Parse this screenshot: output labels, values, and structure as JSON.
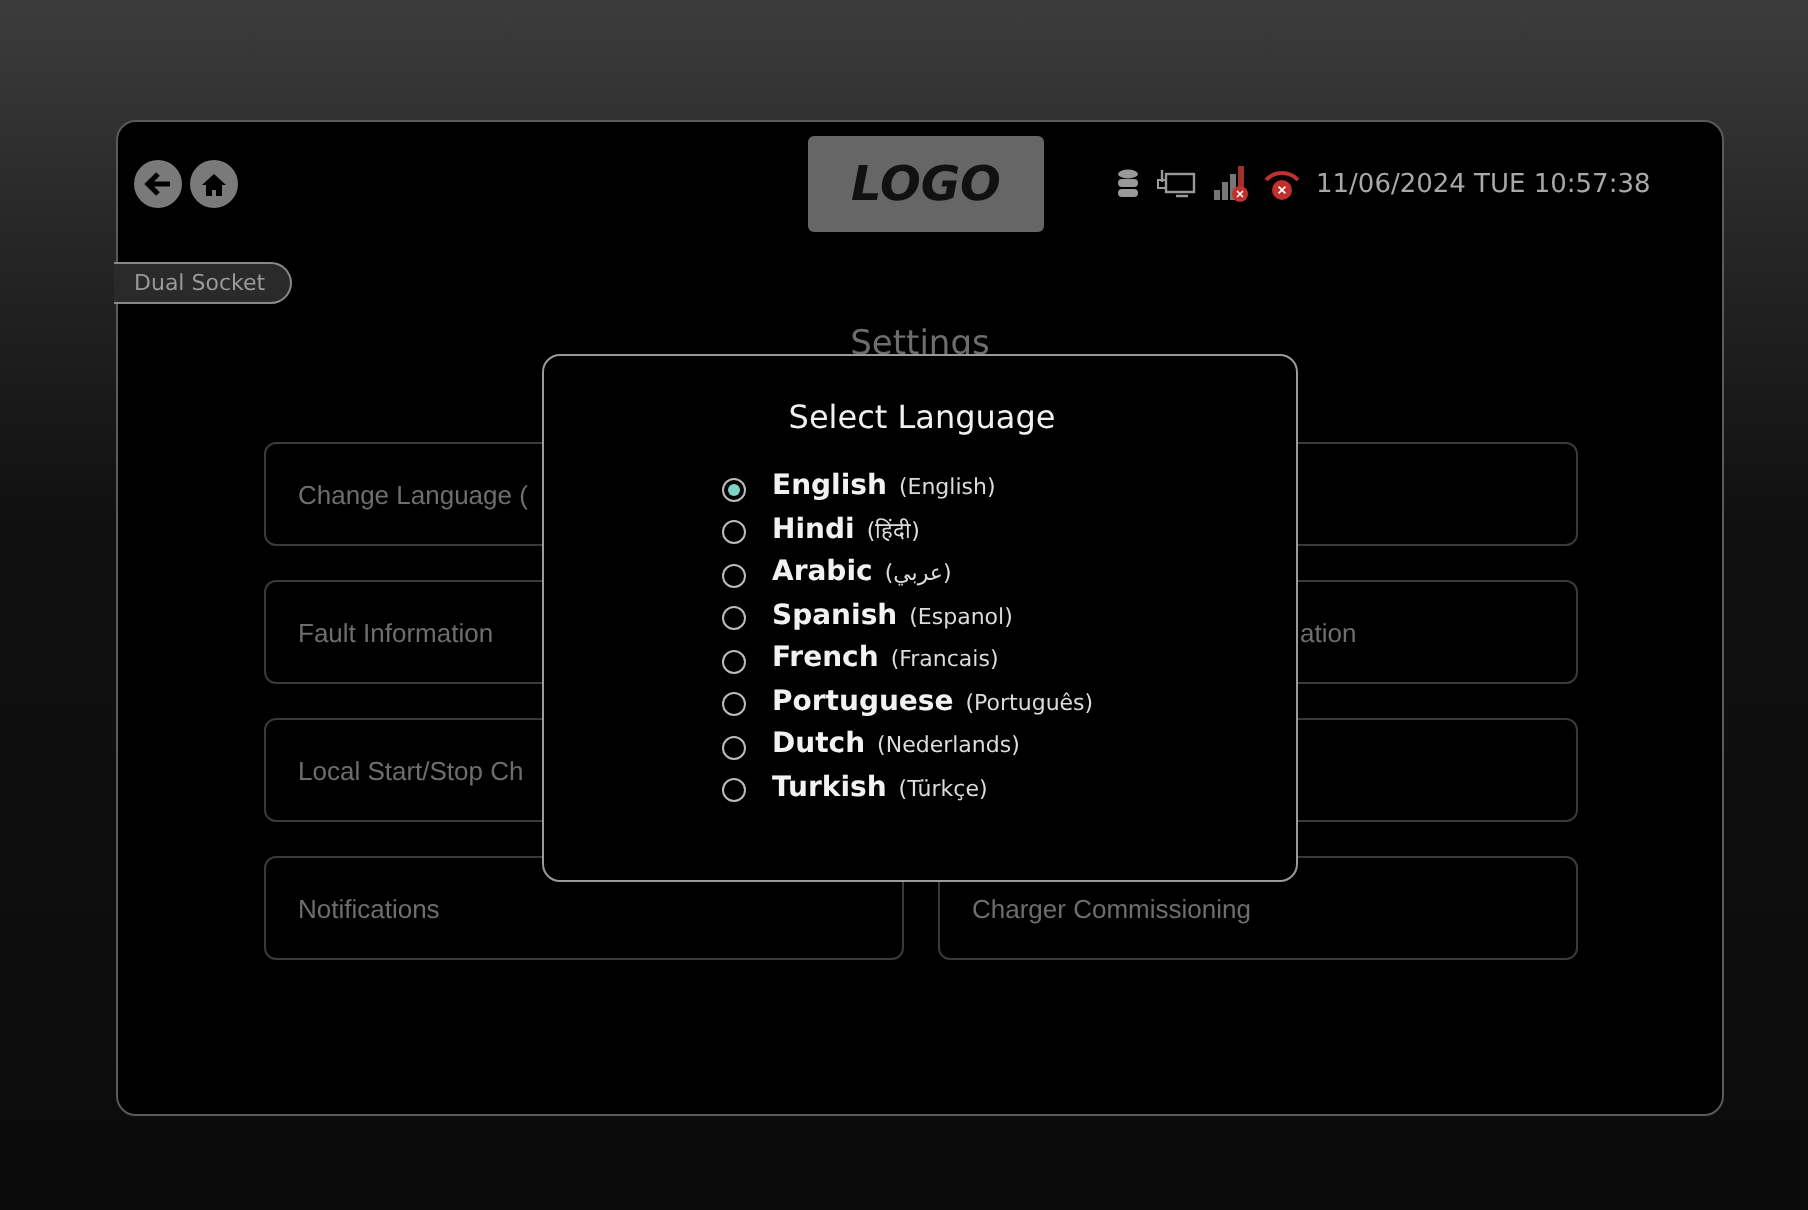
{
  "header": {
    "badge": "Dual Socket",
    "logo": "LOGO",
    "datetime": "11/06/2024 TUE 10:57:38"
  },
  "status_icons": [
    {
      "kind": "database",
      "error": false
    },
    {
      "kind": "monitor",
      "error": false
    },
    {
      "kind": "signal",
      "error": true
    },
    {
      "kind": "wifi",
      "error": true
    }
  ],
  "settings": {
    "title": "Settings",
    "items": [
      {
        "kind": "label",
        "label": "Change Language (",
        "clipped_start": false
      },
      {
        "kind": "blank"
      },
      {
        "kind": "label",
        "label": "Fault Information",
        "clipped_start": false
      },
      {
        "kind": "label",
        "label": "ation",
        "clipped_start": true
      },
      {
        "kind": "label",
        "label": "Local Start/Stop Ch",
        "clipped_start": false
      },
      {
        "kind": "blank"
      },
      {
        "kind": "label",
        "label": "Notifications",
        "clipped_start": false
      },
      {
        "kind": "label",
        "label": "Charger Commissioning",
        "clipped_start": false
      }
    ]
  },
  "dialog": {
    "title": "Select Language",
    "options": [
      {
        "name": "English",
        "native": "(English)",
        "selected": true
      },
      {
        "name": "Hindi",
        "native": "(हिंदी)",
        "selected": false
      },
      {
        "name": "Arabic",
        "native": "(عربي)",
        "selected": false
      },
      {
        "name": "Spanish",
        "native": "(Espanol)",
        "selected": false
      },
      {
        "name": "French",
        "native": "(Francais)",
        "selected": false
      },
      {
        "name": "Portuguese",
        "native": "(Português)",
        "selected": false
      },
      {
        "name": "Dutch",
        "native": "(Nederlands)",
        "selected": false
      },
      {
        "name": "Turkish",
        "native": "(Türkçe)",
        "selected": false
      }
    ]
  }
}
